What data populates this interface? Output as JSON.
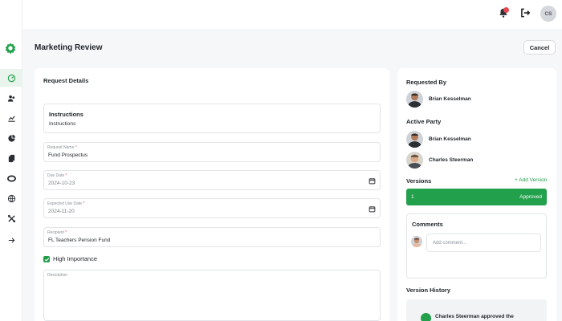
{
  "topbar": {
    "avatar_initials": "CS",
    "notifications_icon": "bell-icon",
    "logout_icon": "logout-icon"
  },
  "page": {
    "title": "Marketing Review",
    "cancel_label": "Cancel"
  },
  "request_details": {
    "section_title": "Request Details",
    "instructions_title": "Instructions",
    "instructions_text": "Instructions",
    "request_name_label": "Request Name",
    "request_name_value": "Fund Prospectus",
    "due_date_label": "Due Date",
    "due_date_value": "2024-10-23",
    "expected_use_date_label": "Expected Use Date",
    "expected_use_date_value": "2024-11-20",
    "recipient_label": "Recipient",
    "recipient_value": "FL Teachers Pension Fund",
    "high_importance_label": "High Importance",
    "high_importance_checked": true,
    "description_label": "Description",
    "required_mark": "*"
  },
  "side": {
    "requested_by_title": "Requested By",
    "requested_by_name": "Brian Kesselman",
    "active_party_title": "Active Party",
    "active_party": [
      "Brian Kesselman",
      "Charles Steerman"
    ],
    "versions_title": "Versions",
    "add_version_label": "+ Add Version",
    "version_number": "1",
    "version_status": "Approved",
    "comments_title": "Comments",
    "comment_placeholder": "Add comment...",
    "history_title": "Version History",
    "history_entry": "Charles Steerman approved the"
  },
  "colors": {
    "accent": "#22a04b",
    "badge": "#e5484d"
  }
}
